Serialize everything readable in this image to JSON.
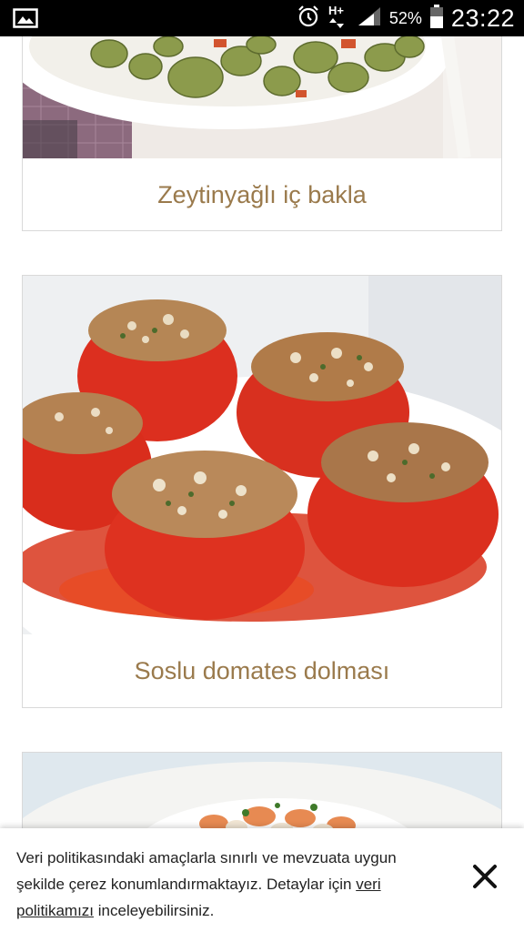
{
  "status_bar": {
    "left_icon": "image-icon",
    "icons": [
      "alarm-icon",
      "network-hplus-icon",
      "signal-icon"
    ],
    "battery_percent": "52%",
    "time": "23:22"
  },
  "recipes": [
    {
      "title": "Zeytinyağlı iç bakla",
      "image": "broad-beans-dish-image"
    },
    {
      "title": "Soslu domates dolması",
      "image": "stuffed-tomatoes-image"
    },
    {
      "title": "",
      "image": "beans-dish-image"
    }
  ],
  "cookie_banner": {
    "text_before": "Veri politikasındaki amaçlarla sınırlı ve mevzuata uygun şekilde çerez konumlandırmaktayız. Detaylar için ",
    "link_text": "veri politikamızı",
    "text_after": " inceleyebilirsiniz.",
    "close_icon": "close-icon"
  },
  "colors": {
    "title_color": "#9a7a4c",
    "status_bar_bg": "#000000",
    "card_border": "#d9d9d9"
  }
}
